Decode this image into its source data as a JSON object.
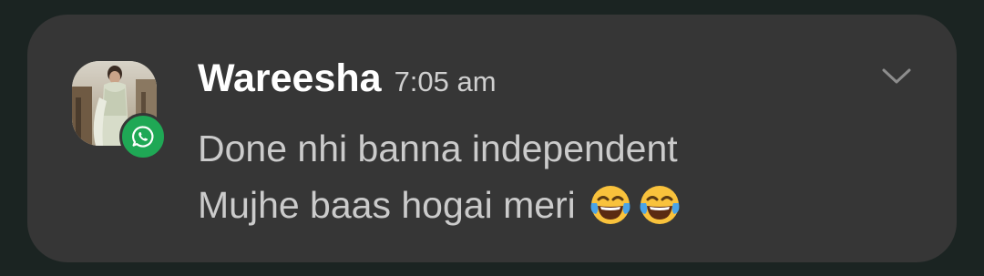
{
  "notification": {
    "app_icon": "whatsapp-icon",
    "sender": "Wareesha",
    "time": "7:05 am",
    "message_lines": [
      "Done nhi banna independent",
      "Mujhe baas hogai meri"
    ],
    "emojis": [
      "face-with-tears-of-joy",
      "face-with-tears-of-joy"
    ],
    "expand_icon": "chevron-down-icon"
  },
  "colors": {
    "card_background": "#363636",
    "page_background": "#1b2422",
    "sender_text": "#ffffff",
    "message_text": "#cbcbcb",
    "whatsapp_green": "#1fa855"
  }
}
